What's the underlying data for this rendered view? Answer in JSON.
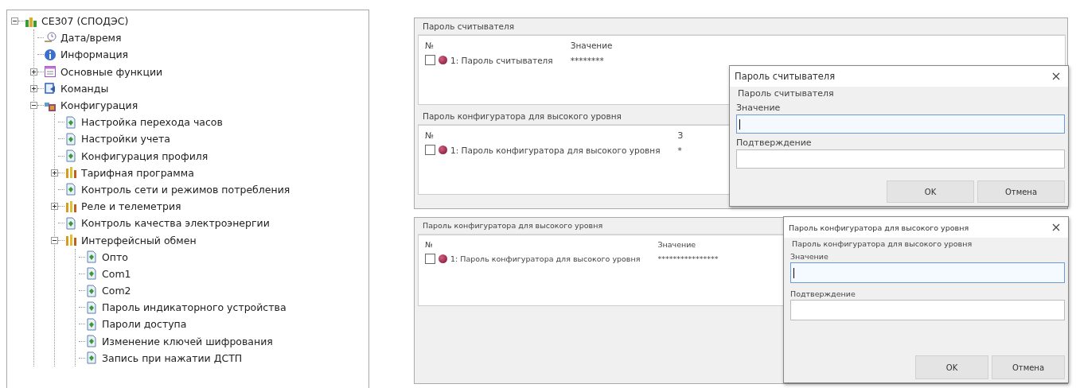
{
  "tree": {
    "items": [
      {
        "label": "CE307 (СПОДЭС)",
        "kind": "device",
        "expanded": true,
        "children": [
          {
            "label": "Дата/время",
            "kind": "clock"
          },
          {
            "label": "Информация",
            "kind": "info"
          },
          {
            "label": "Основные функции",
            "kind": "list",
            "expanded": false
          },
          {
            "label": "Команды",
            "kind": "command",
            "expanded": false
          },
          {
            "label": "Конфигурация",
            "kind": "config",
            "expanded": true,
            "children": [
              {
                "label": "Настройка перехода часов",
                "kind": "doc"
              },
              {
                "label": "Настройки учета",
                "kind": "doc"
              },
              {
                "label": "Конфигурация профиля",
                "kind": "doc"
              },
              {
                "label": "Тарифная программа",
                "kind": "tariff",
                "expanded": false
              },
              {
                "label": "Контроль сети и режимов потребления",
                "kind": "doc"
              },
              {
                "label": "Реле и телеметрия",
                "kind": "tariff",
                "expanded": false
              },
              {
                "label": "Контроль качества электроэнергии",
                "kind": "doc"
              },
              {
                "label": "Интерфейсный обмен",
                "kind": "tariff",
                "expanded": true,
                "children": [
                  {
                    "label": "Опто",
                    "kind": "doc"
                  },
                  {
                    "label": "Com1",
                    "kind": "doc"
                  },
                  {
                    "label": "Com2",
                    "kind": "doc"
                  },
                  {
                    "label": "Пароль индикаторного устройства",
                    "kind": "doc"
                  },
                  {
                    "label": "Пароли доступа",
                    "kind": "doc"
                  },
                  {
                    "label": "Изменение ключей шифрования",
                    "kind": "doc"
                  },
                  {
                    "label": "Запись при нажатии ДСТП",
                    "kind": "doc"
                  }
                ]
              }
            ]
          }
        ]
      }
    ]
  },
  "panels": [
    {
      "groups": [
        {
          "title": "Пароль считывателя",
          "columns": [
            "№",
            "Значение"
          ],
          "rows": [
            {
              "checked": false,
              "label": "1: Пароль считывателя",
              "value": "********"
            }
          ]
        },
        {
          "title": "Пароль конфигуратора для высокого уровня",
          "columns": [
            "№",
            "З"
          ],
          "rows": [
            {
              "checked": false,
              "label": "1: Пароль конфигуратора для высокого уровня",
              "value": "*"
            }
          ]
        }
      ],
      "dialog": {
        "title": "Пароль считывателя",
        "section": "Пароль считывателя",
        "fields": [
          {
            "label": "Значение",
            "focused": true
          },
          {
            "label": "Подтверждение",
            "focused": false
          }
        ],
        "buttons": [
          "OK",
          "Отмена"
        ]
      }
    },
    {
      "groups": [
        {
          "title": "Пароль конфигуратора для высокого уровня",
          "columns": [
            "№",
            "Значение"
          ],
          "rows": [
            {
              "checked": false,
              "label": "1: Пароль конфигуратора для высокого уровня",
              "value": "****************"
            }
          ]
        }
      ],
      "dialog": {
        "title": "Пароль конфигуратора для высокого уровня",
        "section": "Пароль конфигуратора для высокого уровня",
        "fields": [
          {
            "label": "Значение",
            "focused": true
          },
          {
            "label": "Подтверждение",
            "focused": false
          }
        ],
        "buttons": [
          "OK",
          "Отмена"
        ]
      }
    }
  ]
}
